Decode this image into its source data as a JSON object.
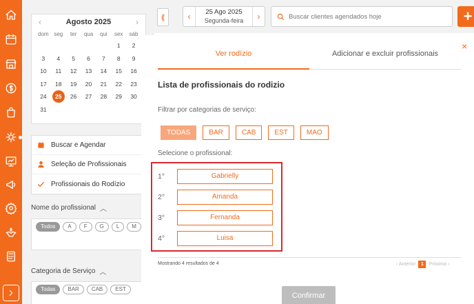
{
  "colors": {
    "brand": "#f26a1b",
    "highlight_box": "#d9282f"
  },
  "sidebar_icons": [
    "home-icon",
    "calendar-icon",
    "store-icon",
    "dollar-icon",
    "shopping-bag-icon",
    "rocket-gear-icon",
    "chart-board-icon",
    "megaphone-icon",
    "settings-icon",
    "handshake-icon",
    "calculator-icon",
    "expand-icon"
  ],
  "calendar": {
    "month": "Agosto 2025",
    "prev": "‹",
    "next": "›",
    "weekdays": [
      "dom",
      "seg",
      "ter",
      "qua",
      "qui",
      "sex",
      "sáb"
    ],
    "days": [
      "",
      "",
      "",
      "",
      "",
      "1",
      "2",
      "3",
      "4",
      "5",
      "6",
      "7",
      "8",
      "9",
      "10",
      "11",
      "12",
      "13",
      "14",
      "15",
      "16",
      "17",
      "18",
      "19",
      "20",
      "21",
      "22",
      "23",
      "24",
      "25",
      "26",
      "27",
      "28",
      "29",
      "30",
      "31",
      "",
      "",
      "",
      "",
      "",
      ""
    ],
    "selected": "25"
  },
  "menu": {
    "items": [
      {
        "label": "Buscar e Agendar",
        "icon": "calendar-icon"
      },
      {
        "label": "Seleção de Profissionais",
        "icon": "user-icon"
      },
      {
        "label": "Profissionais do Rodízio",
        "icon": "check-icon"
      }
    ]
  },
  "filters": {
    "professional_title": "Nome do profissional",
    "professional_pills": [
      "Todos",
      "A",
      "F",
      "G",
      "L",
      "M"
    ],
    "service_title": "Categoria de Serviço",
    "service_pills": [
      "Todas",
      "BAR",
      "CAB",
      "EST"
    ]
  },
  "topbar": {
    "collapse": "⟪",
    "date": "25 Ago 2025",
    "weekday": "Segunda-feira",
    "prev": "‹",
    "next": "›",
    "search_placeholder": "Buscar clientes agendados hoje",
    "add": "+"
  },
  "modal": {
    "tabs": [
      "Ver rodízio",
      "Adicionar e excluir profissionais"
    ],
    "close": "×",
    "title": "Lista de profissionais do rodizio",
    "filter_label": "Filtrar por categorias de serviço:",
    "categories": [
      "TODAS",
      "BAR",
      "CAB",
      "EST",
      "MAO"
    ],
    "select_label": "Selecione o profissional:",
    "professionals": [
      {
        "pos": "1°",
        "name": "Gabrielly"
      },
      {
        "pos": "2°",
        "name": "Amanda"
      },
      {
        "pos": "3°",
        "name": "Fernanda"
      },
      {
        "pos": "4°",
        "name": "Luisa"
      }
    ],
    "results": "Mostrando 4 resultados de 4",
    "pager": {
      "prev": "‹ Anterior",
      "page": "1",
      "next": "Próxima ›"
    },
    "confirm": "Confirmar"
  }
}
